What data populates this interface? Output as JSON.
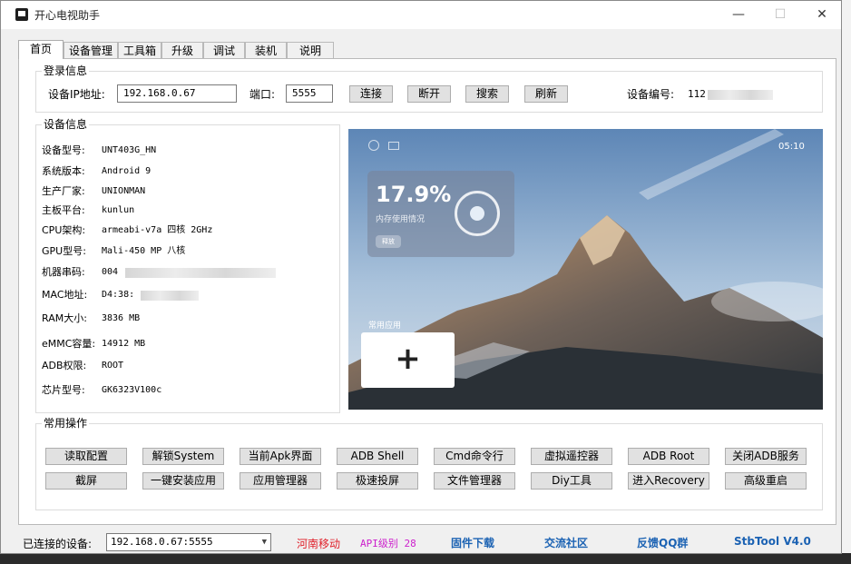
{
  "window": {
    "title": "开心电视助手",
    "min_glyph": "—",
    "max_glyph": "☐",
    "close_glyph": "✕"
  },
  "tabs": [
    "首页",
    "设备管理",
    "工具箱",
    "升级",
    "调试",
    "装机",
    "说明"
  ],
  "login": {
    "group_title": "登录信息",
    "ip_label": "设备IP地址:",
    "ip_value": "192.168.0.67",
    "port_label": "端口:",
    "port_value": "5555",
    "buttons": [
      "连接",
      "断开",
      "搜索",
      "刷新"
    ],
    "device_id_label": "设备编号:",
    "device_id_value": "112"
  },
  "device_info": {
    "group_title": "设备信息",
    "rows": [
      {
        "label": "设备型号:",
        "value": "UNT403G_HN"
      },
      {
        "label": "系统版本:",
        "value": "Android 9"
      },
      {
        "label": "生产厂家:",
        "value": "UNIONMAN"
      },
      {
        "label": "主板平台:",
        "value": "kunlun"
      },
      {
        "label": "CPU架构:",
        "value": "armeabi-v7a 四核 2GHz"
      },
      {
        "label": "GPU型号:",
        "value": "Mali-450 MP 八核"
      },
      {
        "label": "机器串码:",
        "value": "004"
      },
      {
        "label": "MAC地址:",
        "value": "D4:38:"
      },
      {
        "label": "RAM大小:",
        "value": "3836 MB"
      },
      {
        "label": "eMMC容量:",
        "value": "14912 MB"
      },
      {
        "label": "ADB权限:",
        "value": "ROOT"
      },
      {
        "label": "芯片型号:",
        "value": "GK6323V100c"
      }
    ]
  },
  "screenshot": {
    "clock": "05:10",
    "memory_percent": "17.9%",
    "memory_label": "内存使用情况",
    "release_label": "释放",
    "common_apps_label": "常用应用",
    "add_glyph": "+"
  },
  "ops": {
    "group_title": "常用操作",
    "row1": [
      "读取配置",
      "解锁System",
      "当前Apk界面",
      "ADB Shell",
      "Cmd命令行",
      "虚拟遥控器",
      "ADB  Root",
      "关闭ADB服务"
    ],
    "row2": [
      "截屏",
      "一键安装应用",
      "应用管理器",
      "极速投屏",
      "文件管理器",
      "Diy工具",
      "进入Recovery",
      "高级重启"
    ]
  },
  "status_bar": {
    "connected_label": "已连接的设备:",
    "connected_value": "192.168.0.67:5555",
    "carrier": "河南移动",
    "api_level": "API级别 28",
    "links": [
      "固件下载",
      "交流社区",
      "反馈QQ群",
      "StbTool V4.0"
    ],
    "colors": {
      "carrier": "#e0202a",
      "api": "#cc1fcc",
      "link": "#1b62b3"
    }
  }
}
